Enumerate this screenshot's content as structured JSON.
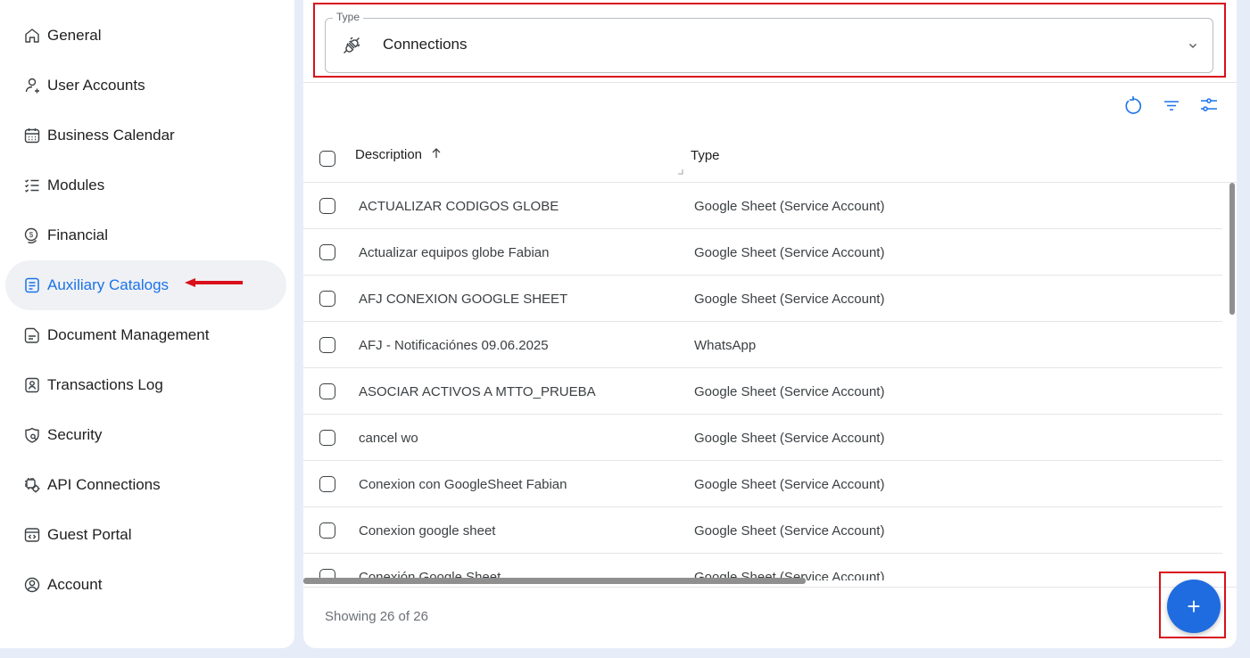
{
  "sidebar": {
    "items": [
      {
        "label": "General",
        "icon": "home-icon"
      },
      {
        "label": "User Accounts",
        "icon": "user-add-icon"
      },
      {
        "label": "Business Calendar",
        "icon": "calendar-icon"
      },
      {
        "label": "Modules",
        "icon": "checklist-icon"
      },
      {
        "label": "Financial",
        "icon": "coin-icon"
      },
      {
        "label": "Auxiliary Catalogs",
        "icon": "catalog-icon",
        "active": true
      },
      {
        "label": "Document Management",
        "icon": "document-icon"
      },
      {
        "label": "Transactions Log",
        "icon": "log-icon"
      },
      {
        "label": "Security",
        "icon": "shield-icon"
      },
      {
        "label": "API Connections",
        "icon": "api-gear-icon"
      },
      {
        "label": "Guest Portal",
        "icon": "portal-icon"
      },
      {
        "label": "Account",
        "icon": "account-icon"
      }
    ]
  },
  "type_select": {
    "legend": "Type",
    "value": "Connections",
    "icon": "plug-icon"
  },
  "toolbar": {
    "icons": [
      "refresh-icon",
      "filter-icon",
      "column-settings-icon"
    ]
  },
  "table": {
    "columns": [
      "Description",
      "Type"
    ],
    "rows": [
      {
        "description": "ACTUALIZAR CODIGOS GLOBE",
        "type": "Google Sheet (Service Account)"
      },
      {
        "description": "Actualizar equipos globe Fabian",
        "type": "Google Sheet (Service Account)"
      },
      {
        "description": "AFJ CONEXION GOOGLE SHEET",
        "type": "Google Sheet (Service Account)"
      },
      {
        "description": "AFJ - Notificaciónes 09.06.2025",
        "type": "WhatsApp"
      },
      {
        "description": "ASOCIAR ACTIVOS A MTTO_PRUEBA",
        "type": "Google Sheet (Service Account)"
      },
      {
        "description": "cancel wo",
        "type": "Google Sheet (Service Account)"
      },
      {
        "description": "Conexion con GoogleSheet Fabian",
        "type": "Google Sheet (Service Account)"
      },
      {
        "description": "Conexion google sheet",
        "type": "Google Sheet (Service Account)"
      },
      {
        "description": "Conexión Google Sheet",
        "type": "Google Sheet (Service Account)"
      }
    ]
  },
  "footer": {
    "showing": "Showing 26 of 26",
    "fab_label": "+"
  },
  "colors": {
    "accent": "#1a73e8",
    "fab": "#1f6ce0",
    "highlight": "#d9101b"
  }
}
